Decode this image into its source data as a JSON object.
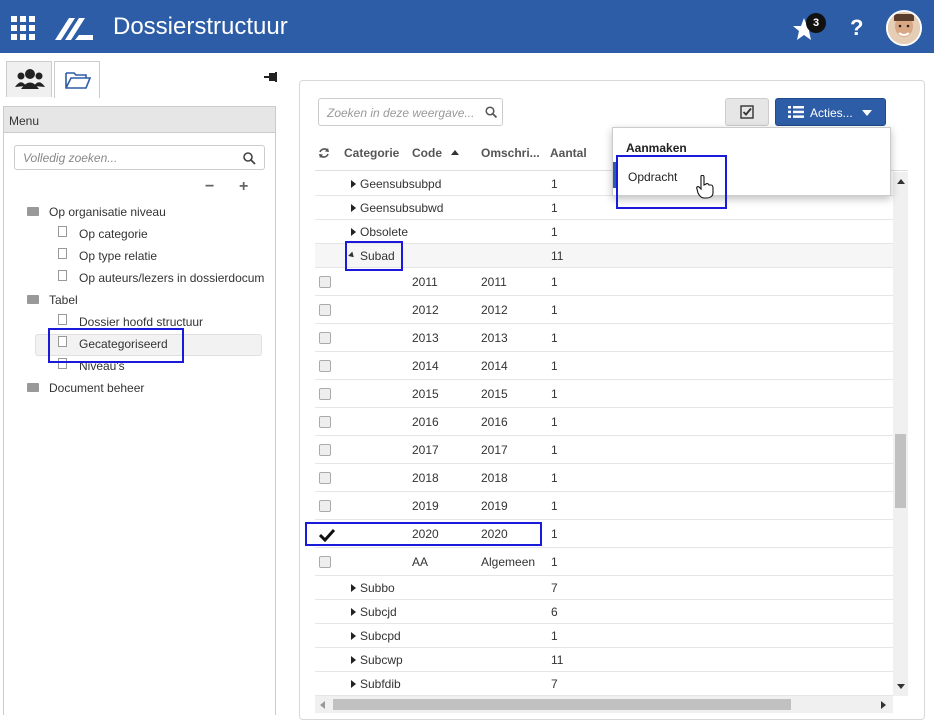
{
  "header": {
    "title": "Dossierstructuur",
    "notification_count": "3",
    "help": "?"
  },
  "left": {
    "menu_title": "Menu",
    "search_placeholder": "Volledig zoeken...",
    "collapse": "−",
    "expand": "+",
    "tree": [
      {
        "label": "Op organisatie niveau",
        "type": "folder-open"
      },
      {
        "label": "Op categorie",
        "type": "doc"
      },
      {
        "label": "Op type relatie",
        "type": "doc"
      },
      {
        "label": "Op auteurs/lezers in dossierdocum",
        "type": "doc"
      },
      {
        "label": "Tabel",
        "type": "folder-open"
      },
      {
        "label": "Dossier hoofd structuur",
        "type": "doc"
      },
      {
        "label": "Gecategoriseerd",
        "type": "doc",
        "selected": true
      },
      {
        "label": "Niveau's",
        "type": "doc"
      },
      {
        "label": "Document beheer",
        "type": "folder"
      }
    ]
  },
  "toolbar": {
    "search_placeholder": "Zoeken in deze weergave...",
    "acties_label": "Acties..."
  },
  "columns": [
    "Categorie",
    "Code",
    "Omschri...",
    "Aantal"
  ],
  "rows": [
    {
      "cat": "Geensubsubpd",
      "code": "",
      "desc": "",
      "count": "1",
      "kind": "group"
    },
    {
      "cat": "Geensubsubwd",
      "code": "",
      "desc": "",
      "count": "1",
      "kind": "group"
    },
    {
      "cat": "Obsolete",
      "code": "",
      "desc": "",
      "count": "1",
      "kind": "group"
    },
    {
      "cat": "Subad",
      "code": "",
      "desc": "",
      "count": "11",
      "kind": "open"
    },
    {
      "cat": "",
      "code": "2011",
      "desc": "2011",
      "count": "1",
      "kind": "item"
    },
    {
      "cat": "",
      "code": "2012",
      "desc": "2012",
      "count": "1",
      "kind": "item"
    },
    {
      "cat": "",
      "code": "2013",
      "desc": "2013",
      "count": "1",
      "kind": "item"
    },
    {
      "cat": "",
      "code": "2014",
      "desc": "2014",
      "count": "1",
      "kind": "item"
    },
    {
      "cat": "",
      "code": "2015",
      "desc": "2015",
      "count": "1",
      "kind": "item"
    },
    {
      "cat": "",
      "code": "2016",
      "desc": "2016",
      "count": "1",
      "kind": "item"
    },
    {
      "cat": "",
      "code": "2017",
      "desc": "2017",
      "count": "1",
      "kind": "item"
    },
    {
      "cat": "",
      "code": "2018",
      "desc": "2018",
      "count": "1",
      "kind": "item"
    },
    {
      "cat": "",
      "code": "2019",
      "desc": "2019",
      "count": "1",
      "kind": "item"
    },
    {
      "cat": "",
      "code": "2020",
      "desc": "2020",
      "count": "1",
      "kind": "item",
      "checked": true
    },
    {
      "cat": "",
      "code": "AA",
      "desc": "Algemeen",
      "count": "1",
      "kind": "item"
    },
    {
      "cat": "Subbo",
      "code": "",
      "desc": "",
      "count": "7",
      "kind": "group"
    },
    {
      "cat": "Subcjd",
      "code": "",
      "desc": "",
      "count": "6",
      "kind": "group"
    },
    {
      "cat": "Subcpd",
      "code": "",
      "desc": "",
      "count": "1",
      "kind": "group"
    },
    {
      "cat": "Subcwp",
      "code": "",
      "desc": "",
      "count": "11",
      "kind": "group"
    },
    {
      "cat": "Subfdib",
      "code": "",
      "desc": "",
      "count": "7",
      "kind": "group"
    }
  ],
  "dropdown": {
    "heading": "Aanmaken",
    "item": "Opdracht"
  },
  "colors": {
    "brand": "#2d5da6",
    "highlight": "#1a1adb"
  }
}
